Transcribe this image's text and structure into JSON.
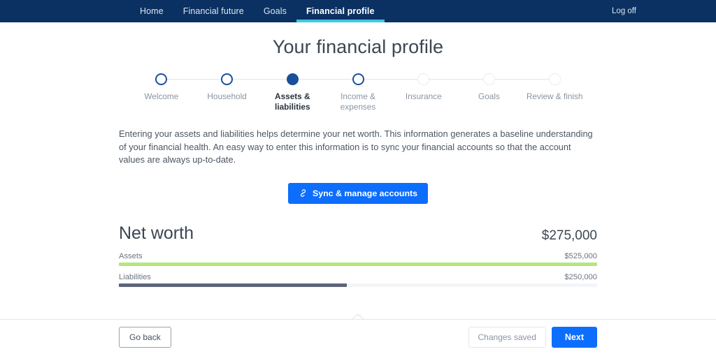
{
  "nav": {
    "items": [
      {
        "label": "Home",
        "active": false
      },
      {
        "label": "Financial future",
        "active": false
      },
      {
        "label": "Goals",
        "active": false
      },
      {
        "label": "Financial profile",
        "active": true
      }
    ],
    "logoff_label": "Log off",
    "background_color": "#0a3161",
    "active_underline_color": "#3fc8e0"
  },
  "header": {
    "title": "Your financial profile"
  },
  "stepper": {
    "steps": [
      {
        "label": "Welcome",
        "state": "done"
      },
      {
        "label": "Household",
        "state": "done"
      },
      {
        "label": "Assets & liabilities",
        "state": "current"
      },
      {
        "label": "Income & expenses",
        "state": "done"
      },
      {
        "label": "Insurance",
        "state": "future"
      },
      {
        "label": "Goals",
        "state": "future"
      },
      {
        "label": "Review & finish",
        "state": "future"
      }
    ],
    "active_color": "#1a4f9c",
    "inactive_color": "#d4d8e0"
  },
  "intro": {
    "text": "Entering your assets and liabilities helps determine your net worth. This information generates a baseline understanding of your financial health. An easy way to enter this information is to sync your financial accounts so that the account values are always up-to-date."
  },
  "sync_button": {
    "label": "Sync & manage accounts",
    "icon": "link-icon",
    "color": "#0d6efd"
  },
  "net_worth": {
    "title": "Net worth",
    "value": "$275,000",
    "bars": [
      {
        "label": "Assets",
        "value": "$525,000",
        "amount": 525000,
        "percent": 100,
        "color": "#b4e77a"
      },
      {
        "label": "Liabilities",
        "value": "$250,000",
        "amount": 250000,
        "percent": 47.6,
        "color": "#5d6579"
      }
    ]
  },
  "divider": {
    "icon": "chevron-up-icon"
  },
  "footer": {
    "back_label": "Go back",
    "saved_label": "Changes saved",
    "next_label": "Next"
  }
}
